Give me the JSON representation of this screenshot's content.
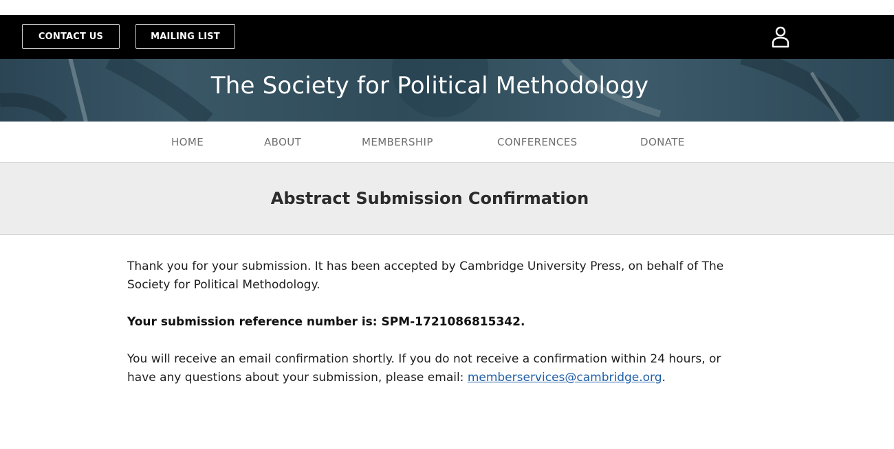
{
  "header": {
    "contact_label": "CONTACT US",
    "mailing_label": "MAILING LIST",
    "site_title": "The Society for Political Methodology"
  },
  "icons": {
    "account": "user-icon"
  },
  "nav": {
    "items": [
      {
        "label": "HOME"
      },
      {
        "label": "ABOUT"
      },
      {
        "label": "MEMBERSHIP"
      },
      {
        "label": "CONFERENCES"
      },
      {
        "label": "DONATE"
      }
    ]
  },
  "page": {
    "title": "Abstract Submission Confirmation"
  },
  "content": {
    "thank_you": "Thank you for your submission. It has been accepted by Cambridge University Press, on behalf of The Society for Political Methodology.",
    "reference": "Your submission reference number is: SPM-1721086815342.",
    "email_notice": "You will receive an email confirmation shortly. If you do not receive a confirmation within 24 hours, or have any questions about your submission, please email: ",
    "email_link": "memberservices@cambridge.org",
    "email_suffix": "."
  },
  "colors": {
    "top_bar": "#000000",
    "banner": "#2f4b59",
    "nav_text": "#6f6f6f",
    "header_band": "#ededed",
    "link": "#1f5fa8"
  }
}
